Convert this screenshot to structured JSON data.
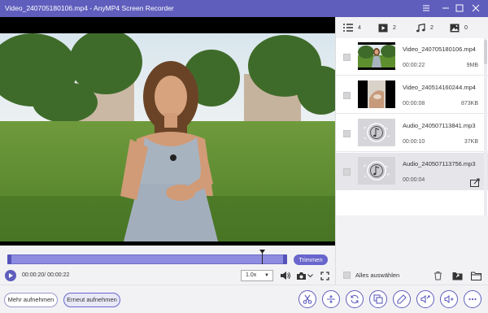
{
  "window": {
    "title": "Video_240705180106.mp4  -  AnyMP4 Screen Recorder",
    "accent": "#5f5ebd"
  },
  "player": {
    "trim_label": "Trimmen",
    "time": "00:00:20/ 00:00:22",
    "speed": "1.0x",
    "playback_progress": 0.91
  },
  "tabs": [
    {
      "icon": "list-icon",
      "count": "4"
    },
    {
      "icon": "video-icon",
      "count": "2"
    },
    {
      "icon": "music-note-icon",
      "count": "2"
    },
    {
      "icon": "image-icon",
      "count": "0"
    }
  ],
  "files": [
    {
      "name": "Video_240705180106.mp4",
      "duration": "00:00:22",
      "size": "9MB",
      "type": "video"
    },
    {
      "name": "Video_240514160244.mp4",
      "duration": "00:00:08",
      "size": "873KB",
      "type": "video"
    },
    {
      "name": "Audio_240507113841.mp3",
      "duration": "00:00:10",
      "size": "37KB",
      "type": "audio"
    },
    {
      "name": "Audio_240507113756.mp3",
      "duration": "00:00:04",
      "size": "",
      "type": "audio"
    }
  ],
  "footer": {
    "select_all": "Alles auswählen"
  },
  "bottom": {
    "record_more": "Mehr aufnehmen",
    "record_again": "Erneut aufnehmen"
  }
}
